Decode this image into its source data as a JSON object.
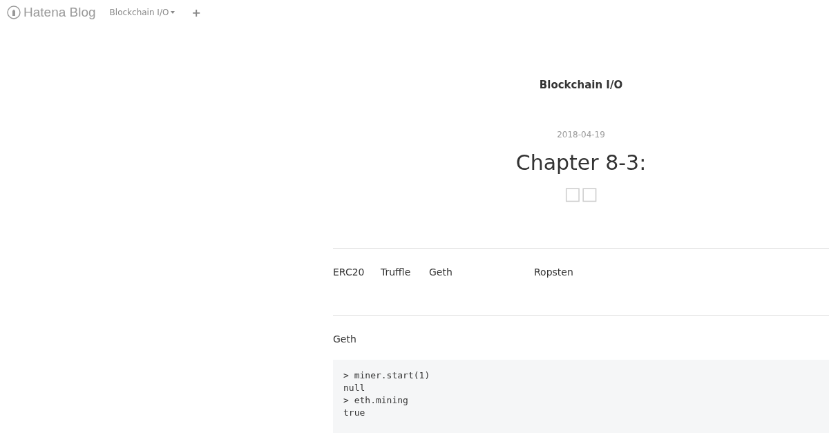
{
  "header": {
    "logo": "Hatena Blog",
    "blog_menu": "Blockchain I/O",
    "add": "+"
  },
  "blog_title": "Blockchain I/O",
  "entry": {
    "date": "2018-04-19",
    "title": "Chapter 8-3:",
    "title_rest": "□□",
    "intro_words": [
      "ERC20",
      "Truffle",
      "Geth",
      "Ropsten"
    ],
    "paragraph": "Geth",
    "code_lines": [
      "> miner.start(1)",
      "null",
      "> eth.mining",
      "true"
    ]
  }
}
